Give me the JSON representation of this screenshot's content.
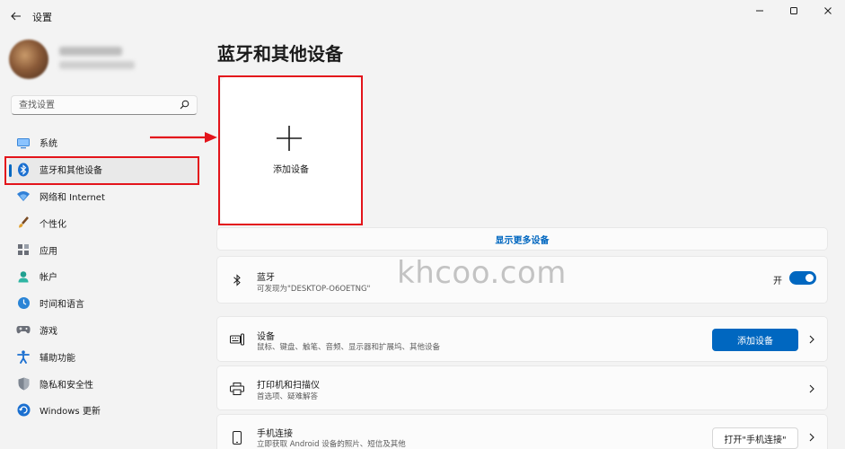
{
  "app": {
    "title": "设置"
  },
  "search": {
    "placeholder": "查找设置"
  },
  "sidebar": {
    "items": [
      {
        "label": "系统",
        "icon": "system-icon"
      },
      {
        "label": "蓝牙和其他设备",
        "icon": "bluetooth-icon",
        "active": true
      },
      {
        "label": "网络和 Internet",
        "icon": "wifi-icon"
      },
      {
        "label": "个性化",
        "icon": "brush-icon"
      },
      {
        "label": "应用",
        "icon": "apps-icon"
      },
      {
        "label": "帐户",
        "icon": "account-icon"
      },
      {
        "label": "时间和语言",
        "icon": "clock-globe-icon"
      },
      {
        "label": "游戏",
        "icon": "gamepad-icon"
      },
      {
        "label": "辅助功能",
        "icon": "accessibility-icon"
      },
      {
        "label": "隐私和安全性",
        "icon": "shield-icon"
      },
      {
        "label": "Windows 更新",
        "icon": "update-icon"
      }
    ]
  },
  "main": {
    "title": "蓝牙和其他设备",
    "add_tile_label": "添加设备",
    "show_more": "显示更多设备",
    "bluetooth": {
      "title": "蓝牙",
      "subtitle": "可发现为\"DESKTOP-O6OETNG\"",
      "toggle_label": "开",
      "enabled": true
    },
    "devices": {
      "title": "设备",
      "subtitle": "鼠标、键盘、触笔、音频、显示器和扩展坞、其他设备",
      "button": "添加设备"
    },
    "printers": {
      "title": "打印机和扫描仪",
      "subtitle": "首选项、疑难解答"
    },
    "phone": {
      "title": "手机连接",
      "subtitle": "立即获取 Android 设备的照片、短信及其他",
      "button": "打开\"手机连接\""
    }
  },
  "watermark": "khcoo.com",
  "colors": {
    "accent": "#0067c0",
    "highlight": "#e3141b",
    "background": "#f3f3f3"
  }
}
